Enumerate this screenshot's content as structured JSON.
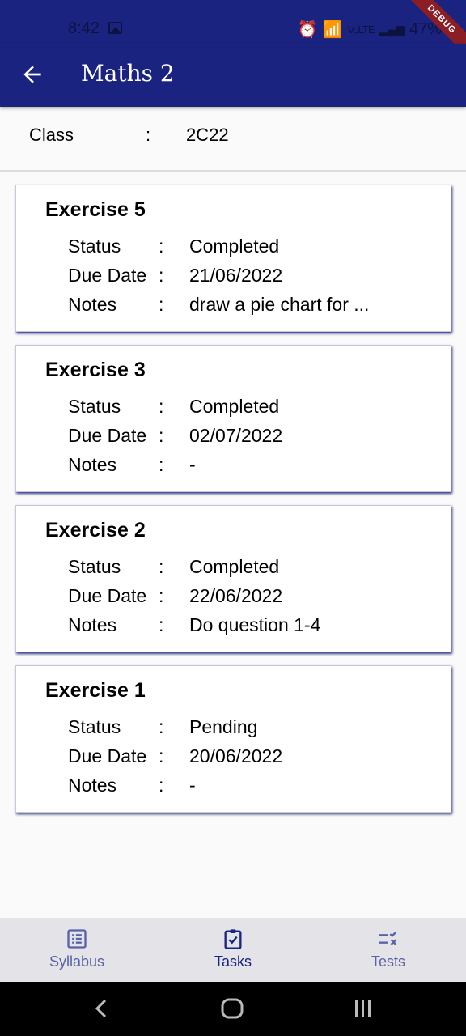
{
  "status_bar": {
    "time": "8:42",
    "battery": "47%",
    "network_small": "VoLTE"
  },
  "debug_banner": "DEBUG",
  "app_bar": {
    "title": "Maths 2"
  },
  "class_info": {
    "label": "Class",
    "separator": ":",
    "value": "2C22"
  },
  "exercises": [
    {
      "name": "Exercise 5",
      "status_label": "Status",
      "status": "Completed",
      "due_label": "Due Date",
      "due": "21/06/2022",
      "notes_label": "Notes",
      "notes": "draw a pie chart for ...",
      "sep": ":"
    },
    {
      "name": "Exercise 3",
      "status_label": "Status",
      "status": "Completed",
      "due_label": "Due Date",
      "due": "02/07/2022",
      "notes_label": "Notes",
      "notes": "-",
      "sep": ":"
    },
    {
      "name": "Exercise 2",
      "status_label": "Status",
      "status": "Completed",
      "due_label": "Due Date",
      "due": "22/06/2022",
      "notes_label": "Notes",
      "notes": "Do question 1-4",
      "sep": ":"
    },
    {
      "name": "Exercise 1",
      "status_label": "Status",
      "status": "Pending",
      "due_label": "Due Date",
      "due": "20/06/2022",
      "notes_label": "Notes",
      "notes": "-",
      "sep": ":"
    }
  ],
  "bottom_nav": {
    "items": [
      {
        "label": "Syllabus",
        "icon": "list-alt-icon"
      },
      {
        "label": "Tasks",
        "icon": "assignment-check-icon",
        "active": true
      },
      {
        "label": "Tests",
        "icon": "rule-icon"
      }
    ]
  },
  "colors": {
    "primary": "#1a2380",
    "inactive_nav": "#5a62a8",
    "debug": "#8b1d24"
  }
}
